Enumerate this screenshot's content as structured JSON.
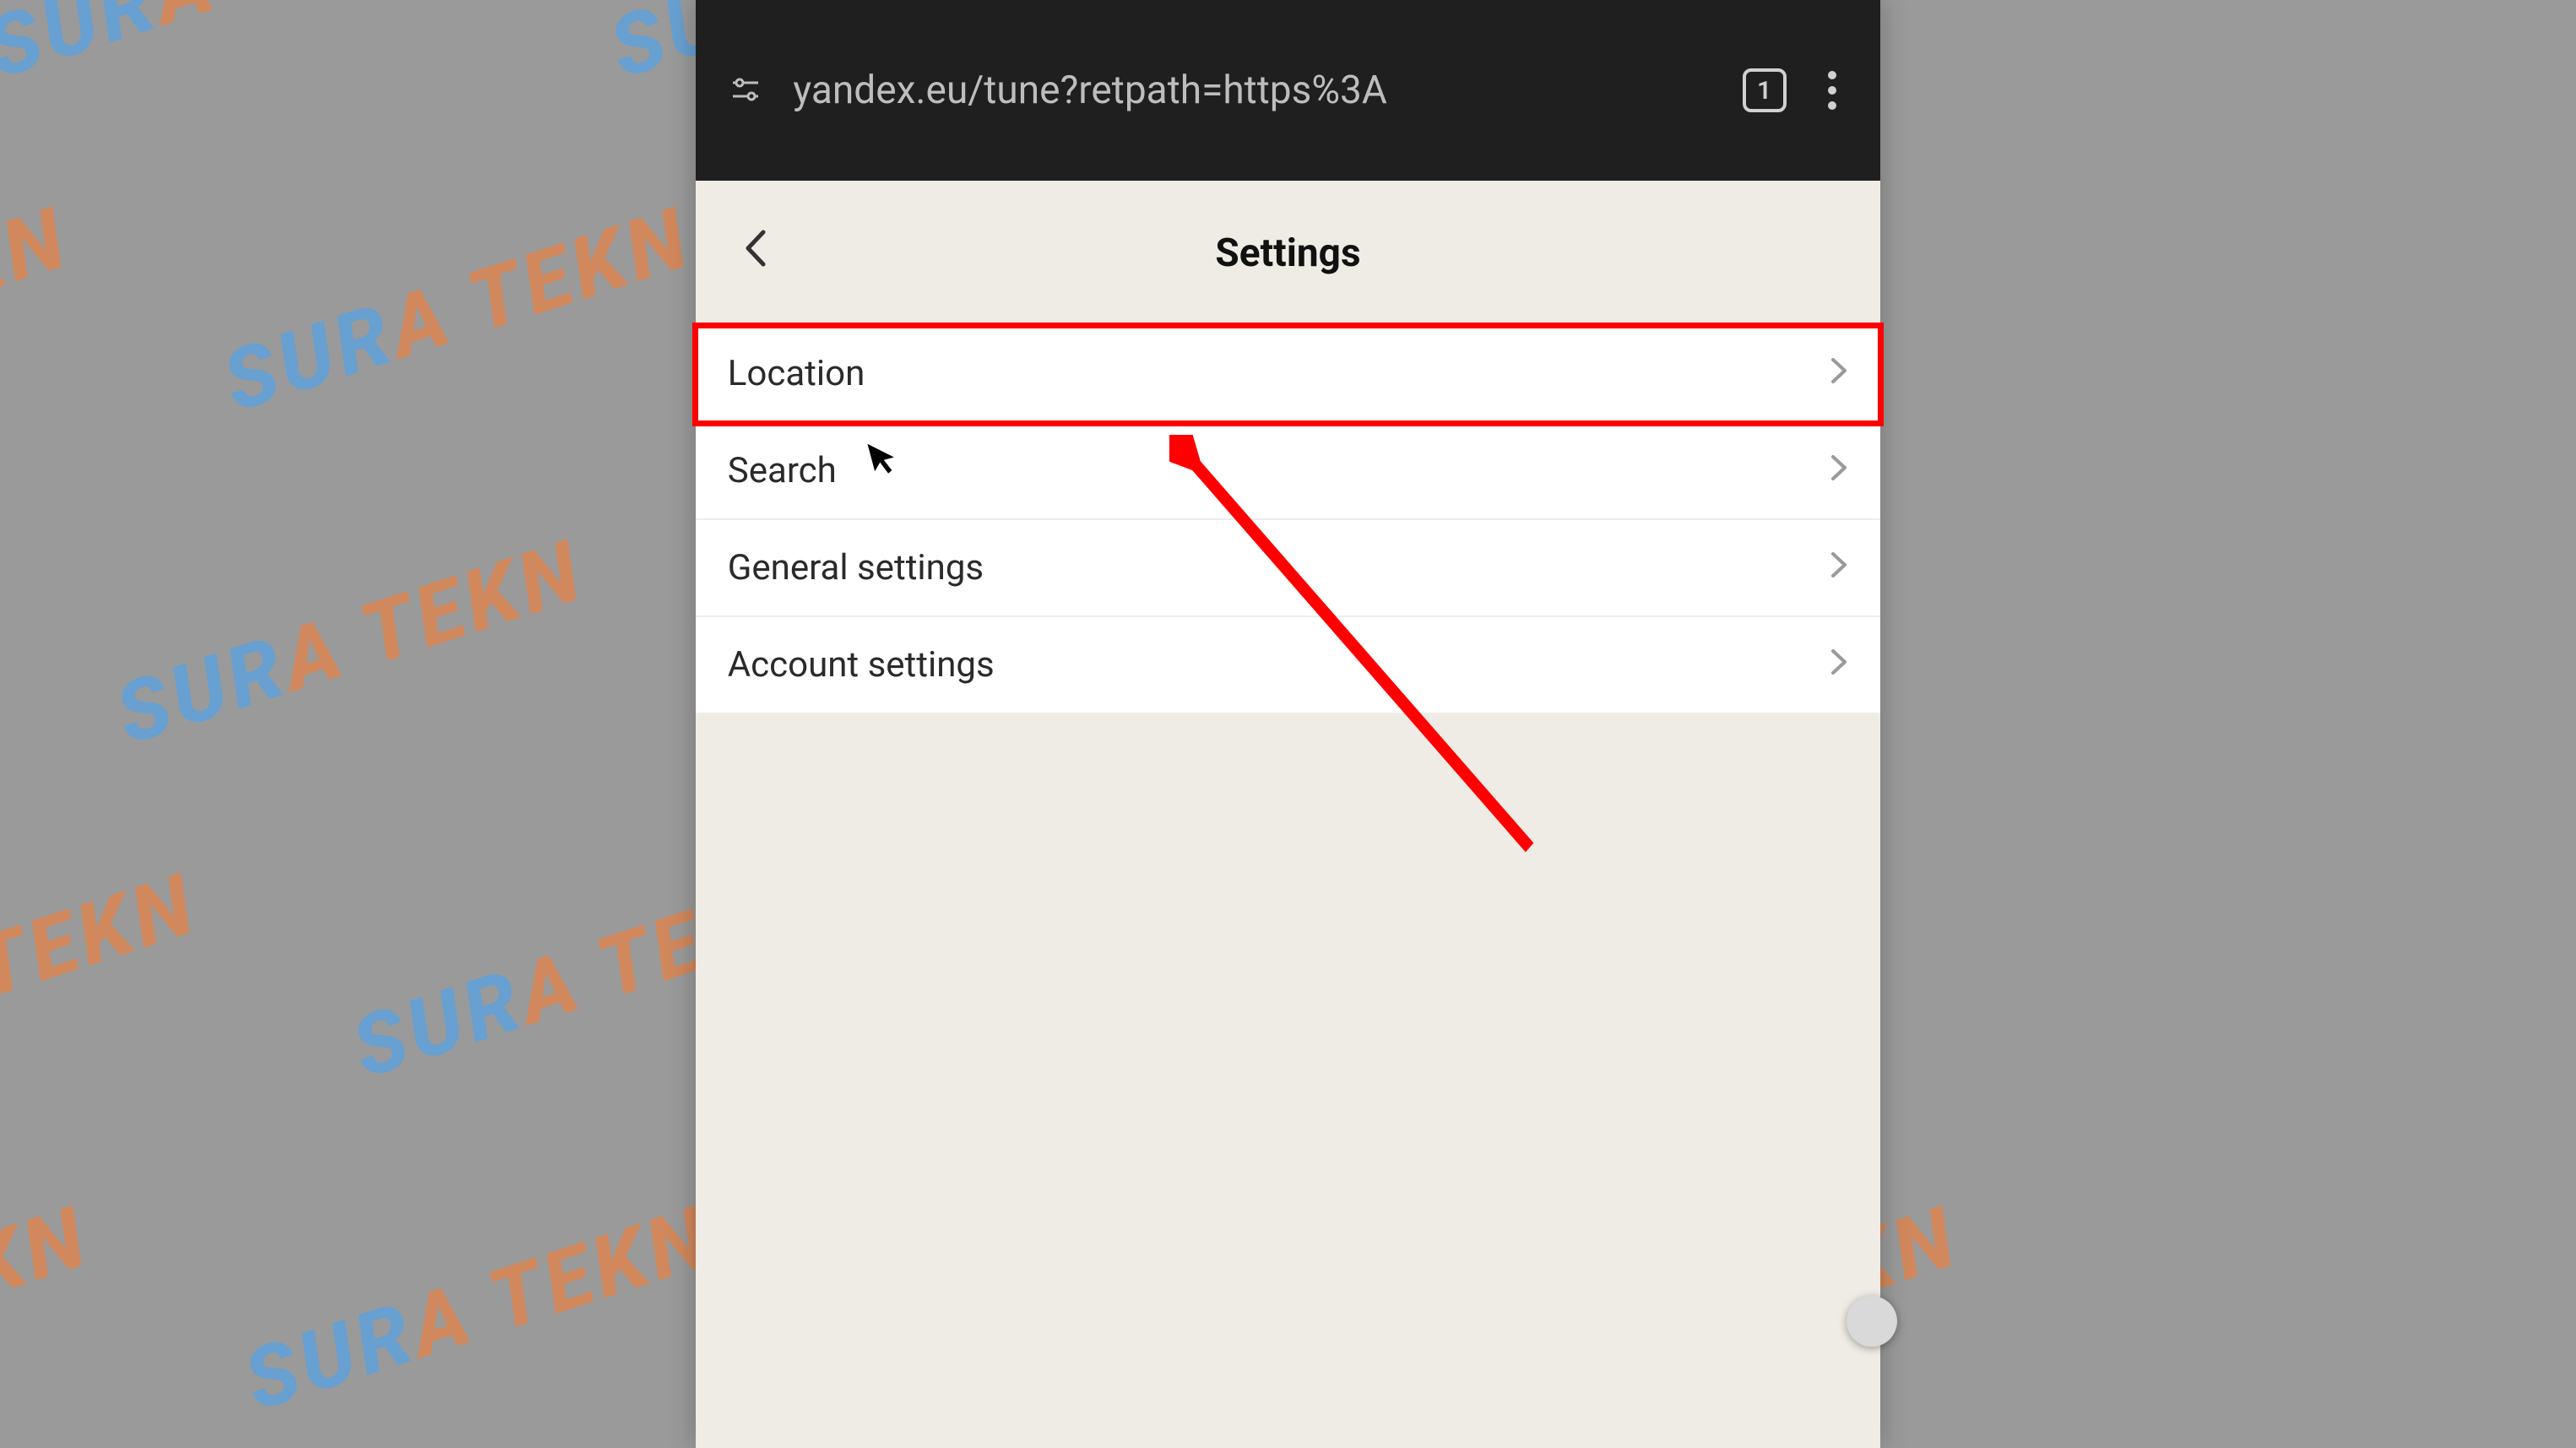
{
  "browser": {
    "url": "yandex.eu/tune?retpath=https%3A",
    "tab_count": "1"
  },
  "page": {
    "title": "Settings"
  },
  "settings": {
    "items": [
      {
        "label": "Location"
      },
      {
        "label": "Search"
      },
      {
        "label": "General settings"
      },
      {
        "label": "Account settings"
      }
    ]
  },
  "watermark": {
    "text_a": "SUR",
    "text_b": "A TEKN"
  }
}
